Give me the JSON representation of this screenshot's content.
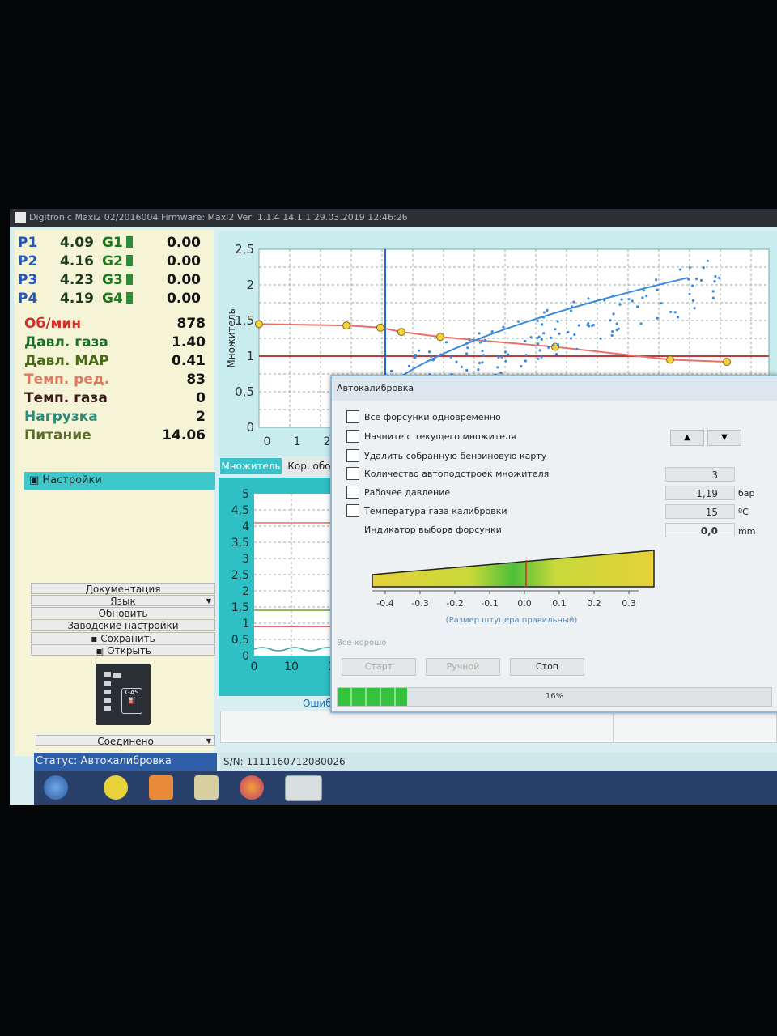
{
  "window": {
    "title": "Digitronic Maxi2 02/2016004  Firmware: Maxi2  Ver: 1.1.4  14.1.1  29.03.2019 12:46:26"
  },
  "pressures": [
    {
      "label": "P1",
      "value": "4.09",
      "gas": "G1",
      "gas_value": "0.00"
    },
    {
      "label": "P2",
      "value": "4.16",
      "gas": "G2",
      "gas_value": "0.00"
    },
    {
      "label": "P3",
      "value": "4.23",
      "gas": "G3",
      "gas_value": "0.00"
    },
    {
      "label": "P4",
      "value": "4.19",
      "gas": "G4",
      "gas_value": "0.00"
    }
  ],
  "params": [
    {
      "label": "Об/мин",
      "value": "878",
      "color": "#d0302a"
    },
    {
      "label": "Давл. газа",
      "value": "1.40",
      "color": "#1b6f2a"
    },
    {
      "label": "Давл. MAP",
      "value": "0.41",
      "color": "#4a6a1a"
    },
    {
      "label": "Темп. ред.",
      "value": "83",
      "color": "#e07860"
    },
    {
      "label": "Темп. газа",
      "value": "0",
      "color": "#3a1a1a"
    },
    {
      "label": "Нагрузка",
      "value": "2",
      "color": "#2a8a7a"
    },
    {
      "label": "Питание",
      "value": "14.06",
      "color": "#5a6a2a"
    }
  ],
  "settings_label": "Настройки",
  "menu": [
    "Документация",
    "Язык",
    "Обновить",
    "Заводские настройки",
    "Сохранить",
    "Открыть"
  ],
  "connection_label": "Соединено",
  "gas_badge": "GAS",
  "status": "Статус: Автокалибровка",
  "serial": "S/N: 1111160712080026",
  "tabs": {
    "multiplier": "Множитель",
    "correction": "Кор. обо"
  },
  "errors_label": "Ошиб",
  "chart_data": [
    {
      "type": "scatter",
      "ylabel": "Множитель",
      "yticks": [
        "2,5",
        "2",
        "1,5",
        "1",
        "0,5",
        "0"
      ],
      "xticks": [
        "0",
        "1",
        "2"
      ],
      "ylim": [
        0,
        2.5
      ],
      "grid": true,
      "red_line": [
        1.45,
        1.43,
        1.4,
        1.34,
        1.27,
        1.13,
        0.95,
        0.92
      ],
      "thin_line": 1.0
    },
    {
      "type": "line",
      "yticks": [
        "5",
        "4,5",
        "4",
        "3,5",
        "3",
        "2,5",
        "2",
        "1,5",
        "1",
        "0,5",
        "0"
      ],
      "xticks": [
        "0",
        "10",
        "2"
      ],
      "ylim": [
        0,
        5
      ],
      "grid": true
    }
  ],
  "dialog": {
    "title": "Автокалибровка",
    "options": [
      "Все форсунки одновременно",
      "Начните с текущего множителя",
      "Удалить собранную бензиновую карту",
      "Количество автоподстроек множителя",
      "Рабочее давление",
      "Температура газа калибровки"
    ],
    "injector_indicator": "Индикатор выбора форсунки",
    "count_value": "3",
    "pressure_value": "1,19",
    "pressure_unit": "бар",
    "temp_value": "15",
    "temp_unit": "ºC",
    "nozzle_value": "0,0",
    "nozzle_unit": "mm",
    "scale": [
      "-0.4",
      "-0.3",
      "-0.2",
      "-0.1",
      "0.0",
      "0.1",
      "0.2",
      "0.3"
    ],
    "scale_caption": "(Размер штуцера правильный)",
    "state": "Все хорошо",
    "buttons": {
      "start": "Старт",
      "manual": "Ручной",
      "stop": "Стоп"
    },
    "progress_percent": "16%",
    "progress": 0.16
  }
}
